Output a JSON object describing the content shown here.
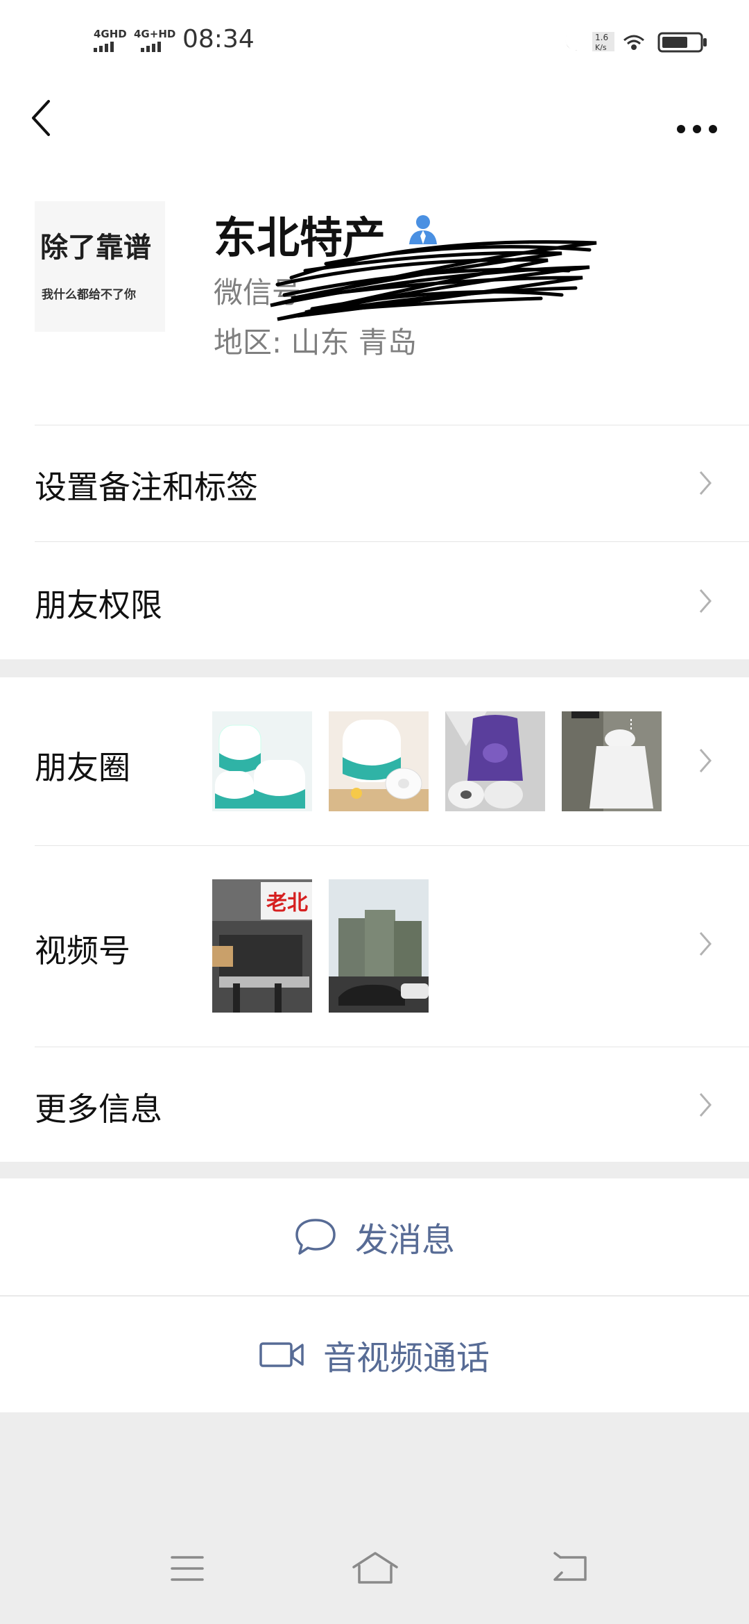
{
  "status_bar": {
    "sig1_label": "4GHD",
    "sig2_label": "4G+HD",
    "time": "08:34",
    "icons": [
      "moon-icon",
      "data-speed-icon",
      "wifi-icon",
      "battery-icon"
    ]
  },
  "header": {
    "back_icon": "chevron-left-icon",
    "more_icon": "more-dots-icon"
  },
  "profile": {
    "avatar_line1": "除了靠谱",
    "avatar_line2": "我什么都给不了你",
    "name": "东北特产",
    "wechat_id_label": "微信号",
    "region": "地区:  山东  青岛"
  },
  "rows": {
    "remark": "设置备注和标签",
    "permissions": "朋友权限",
    "moments": "朋友圈",
    "channels": "视频号",
    "more_info": "更多信息"
  },
  "actions": {
    "message": "发消息",
    "call": "音视频通话"
  },
  "colors": {
    "link_blue": "#576b95",
    "background": "#ededed",
    "text": "#111111",
    "secondary_text": "#7f7f7f",
    "icon_blue": "#4a90e2"
  }
}
